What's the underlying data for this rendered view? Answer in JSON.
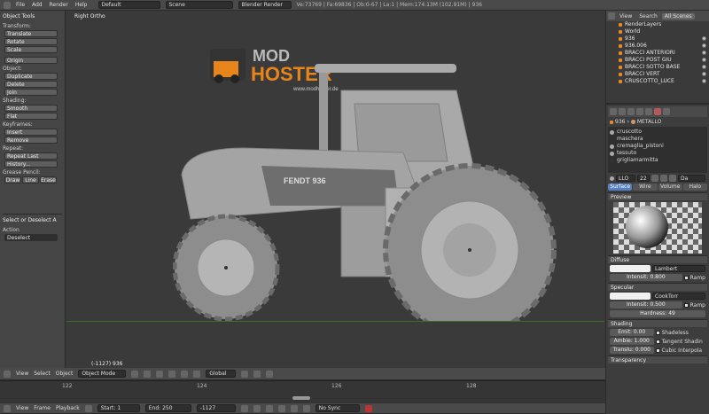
{
  "topbar": {
    "menus": [
      "File",
      "Add",
      "Render",
      "Help"
    ],
    "layout": "Default",
    "scene": "Scene",
    "engine": "Blender Render",
    "stats": "Ve:73769 | Fa:69836 | Ob:0-67 | La:1 | Mem:174.13M (102.91M) | 936"
  },
  "toolshelf": {
    "title": "Object Tools",
    "transform": "Transform:",
    "translate": "Translate",
    "rotate": "Rotate",
    "scale": "Scale",
    "origin": "Origin",
    "object": "Object:",
    "duplicate": "Duplicate",
    "delete": "Delete",
    "join": "Join",
    "shading": "Shading:",
    "smooth": "Smooth",
    "flat": "Flat",
    "keyframes": "Keyframes:",
    "insert": "Insert",
    "remove": "Remove",
    "repeat": "Repeat:",
    "repeat_last": "Repeat Last",
    "history": "History...",
    "grease": "Grease Pencil:",
    "draw": "Draw",
    "line": "Line",
    "erase": "Erase",
    "op_title": "Select or Deselect A",
    "action_label": "Action",
    "action_value": "Deselect"
  },
  "viewport": {
    "view_label": "Right Ortho",
    "object_label": "(-1127) 936",
    "logo_top": "MOD",
    "logo_bottom": "HOSTER",
    "logo_url": "www.modhoster.de",
    "decal": "FENDT 936"
  },
  "outliner": {
    "tabs": [
      "View",
      "Search",
      "All Scenes"
    ],
    "items": [
      "RenderLayers",
      "World",
      "936",
      "936.006",
      "BRACCI ANTERIORI",
      "BRACCI POST GIU",
      "BRACCI SOTTO BASE",
      "BRACCI VERT",
      "CRUSCOTTO_LUCE"
    ]
  },
  "properties": {
    "object_name": "936",
    "material_name": "METALLO",
    "materials": [
      "cruscotto",
      "maschera",
      "cremaglia_pistoni",
      "tessuto",
      "grigliamarmitta"
    ],
    "mat_slot": "LLO",
    "mat_users": "22",
    "mat_extra": "Da",
    "tabs": [
      "Surface",
      "Wire",
      "Volume",
      "Halo"
    ],
    "preview": "Preview",
    "diffuse": "Diffuse",
    "diffuse_shader": "Lambert",
    "diffuse_intensity": "Intensit: 0.800",
    "ramp": "Ramp",
    "specular": "Specular",
    "spec_shader": "CookTorr",
    "spec_intensity": "Intensit: 0.500",
    "hardness": "Hardness: 49",
    "shading": "Shading",
    "emit": "Emit: 0.00",
    "ambient": "Ambie: 1.000",
    "translucency": "Translu: 0.000",
    "shadeless": "Shadeless",
    "tangent": "Tangent Shadin",
    "cubic": "Cubic Interpola",
    "transparency": "Transparency"
  },
  "viewheader": {
    "menus": [
      "View",
      "Select",
      "Object"
    ],
    "mode": "Object Mode",
    "orientation": "Global"
  },
  "timeline": {
    "ticks": [
      "122",
      "124",
      "126",
      "128"
    ],
    "menus": [
      "View",
      "Frame",
      "Playback"
    ],
    "start": "Start: 1",
    "end": "End: 250",
    "current": "-1127",
    "sync": "No Sync"
  }
}
